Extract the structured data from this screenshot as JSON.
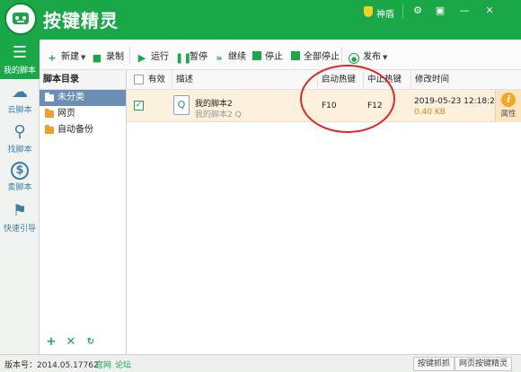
{
  "app": {
    "title": "按键精灵",
    "shield_label": "神盾",
    "title_buttons": [
      {
        "icon": "gear-icon",
        "glyph": "⚙"
      },
      {
        "icon": "skin-icon",
        "glyph": "▣"
      },
      {
        "icon": "minimize-icon",
        "glyph": "—"
      },
      {
        "icon": "close-icon",
        "glyph": "✕"
      }
    ]
  },
  "nav": {
    "items": [
      {
        "label": "我的脚本",
        "glyph": "☰",
        "icon": "list-icon",
        "active": true
      },
      {
        "label": "云脚本",
        "glyph": "☁",
        "icon": "cloud-icon",
        "active": false
      },
      {
        "label": "找脚本",
        "glyph": "⚲",
        "icon": "search-icon",
        "active": false
      },
      {
        "label": "卖脚本",
        "glyph": "$",
        "icon": "dollar-icon",
        "active": false
      },
      {
        "label": "快速引导",
        "glyph": "⚑",
        "icon": "signpost-icon",
        "active": false
      }
    ]
  },
  "toolbar": {
    "new_label": "新建",
    "record_label": "录制",
    "run_label": "运行",
    "pause_label": "暂停",
    "resume_label": "继续",
    "stop_label": "停止",
    "stop_all_label": "全部停止",
    "publish_label": "发布"
  },
  "tree": {
    "header": "脚本目录",
    "items": [
      {
        "label": "未分类",
        "selected": true
      },
      {
        "label": "网页",
        "selected": false
      },
      {
        "label": "自动备份",
        "selected": false
      }
    ]
  },
  "table": {
    "headers": {
      "enabled": "有效",
      "description": "描述",
      "start_hotkey": "启动热键",
      "stop_hotkey": "中止热键",
      "modified": "修改时间"
    },
    "rows": [
      {
        "checked": true,
        "name": "我的脚本2",
        "subtitle": "我的脚本2 Q",
        "start_hotkey": "F10",
        "stop_hotkey": "F12",
        "modified": "2019-05-23 12:18:28",
        "size": "0.40 KB",
        "properties_label": "属性"
      }
    ]
  },
  "status": {
    "version": "版本号：2014.05.17762",
    "official_site": "官网",
    "forum": "论坛",
    "hotkey_capture": "按键抓抓",
    "web_macro": "网页按键精灵"
  },
  "colors": {
    "brand_green": "#1aa748",
    "selected_row": "#fdf0dc",
    "annotation_red": "#e02828"
  }
}
